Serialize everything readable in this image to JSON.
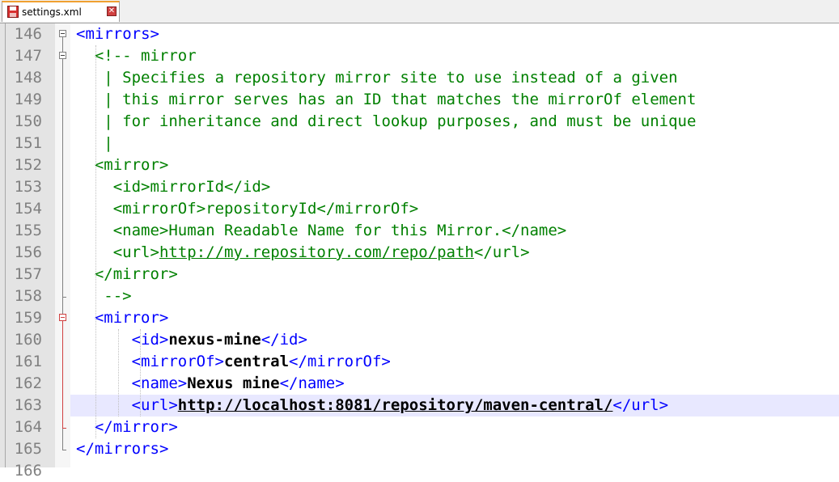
{
  "tab": {
    "label": "settings.xml",
    "icon": "floppy-disk-icon",
    "close": "✕"
  },
  "colors": {
    "tag": "#0000ff",
    "comment": "#008000",
    "text": "#000000",
    "current_line": "#e8e8ff"
  },
  "lines": [
    {
      "n": "146",
      "indent": 1,
      "parts": [
        [
          "tag",
          "<mirrors>"
        ]
      ]
    },
    {
      "n": "147",
      "indent": 2,
      "parts": [
        [
          "cm",
          "<!-- mirror"
        ]
      ]
    },
    {
      "n": "148",
      "indent": 2,
      "parts": [
        [
          "cm",
          " | Specifies a repository mirror site to use instead of a given"
        ]
      ]
    },
    {
      "n": "149",
      "indent": 2,
      "parts": [
        [
          "cm",
          " | this mirror serves has an ID that matches the mirrorOf element"
        ]
      ]
    },
    {
      "n": "150",
      "indent": 2,
      "parts": [
        [
          "cm",
          " | for inheritance and direct lookup purposes, and must be unique"
        ]
      ]
    },
    {
      "n": "151",
      "indent": 2,
      "parts": [
        [
          "cm",
          " |"
        ]
      ]
    },
    {
      "n": "152",
      "indent": 2,
      "parts": [
        [
          "cm",
          "<mirror>"
        ]
      ]
    },
    {
      "n": "153",
      "indent": 2,
      "parts": [
        [
          "cm",
          "  <id>mirrorId</id>"
        ]
      ]
    },
    {
      "n": "154",
      "indent": 2,
      "parts": [
        [
          "cm",
          "  <mirrorOf>repositoryId</mirrorOf>"
        ]
      ]
    },
    {
      "n": "155",
      "indent": 2,
      "parts": [
        [
          "cm",
          "  <name>Human Readable Name for this Mirror.</name>"
        ]
      ]
    },
    {
      "n": "156",
      "indent": 2,
      "parts": [
        [
          "cm",
          "  <url>"
        ],
        [
          "cm url",
          "http://my.repository.com/repo/path"
        ],
        [
          "cm",
          "</url>"
        ]
      ]
    },
    {
      "n": "157",
      "indent": 2,
      "parts": [
        [
          "cm",
          "</mirror>"
        ]
      ]
    },
    {
      "n": "158",
      "indent": 2,
      "parts": [
        [
          "cm",
          " -->"
        ]
      ]
    },
    {
      "n": "159",
      "indent": 2,
      "parts": [
        [
          "tag",
          "<mirror>"
        ]
      ]
    },
    {
      "n": "160",
      "indent": 4,
      "parts": [
        [
          "tag",
          "<id>"
        ],
        [
          "bold",
          "nexus-mine"
        ],
        [
          "tag",
          "</id>"
        ]
      ]
    },
    {
      "n": "161",
      "indent": 4,
      "parts": [
        [
          "tag",
          "<mirrorOf>"
        ],
        [
          "bold",
          "central"
        ],
        [
          "tag",
          "</mirrorOf>"
        ]
      ]
    },
    {
      "n": "162",
      "indent": 4,
      "parts": [
        [
          "tag",
          "<name>"
        ],
        [
          "bold",
          "Nexus mine"
        ],
        [
          "tag",
          "</name>"
        ]
      ]
    },
    {
      "n": "163",
      "indent": 4,
      "parts": [
        [
          "tag",
          "<url>"
        ],
        [
          "bold url",
          "http://localhost:8081/repository/maven-central/"
        ],
        [
          "tag",
          "</url>"
        ]
      ],
      "current": true
    },
    {
      "n": "164",
      "indent": 2,
      "parts": [
        [
          "tag",
          "</mirror>"
        ]
      ]
    },
    {
      "n": "165",
      "indent": 1,
      "parts": [
        [
          "tag",
          "</mirrors>"
        ]
      ]
    },
    {
      "n": "166",
      "indent": 0,
      "parts": []
    }
  ]
}
